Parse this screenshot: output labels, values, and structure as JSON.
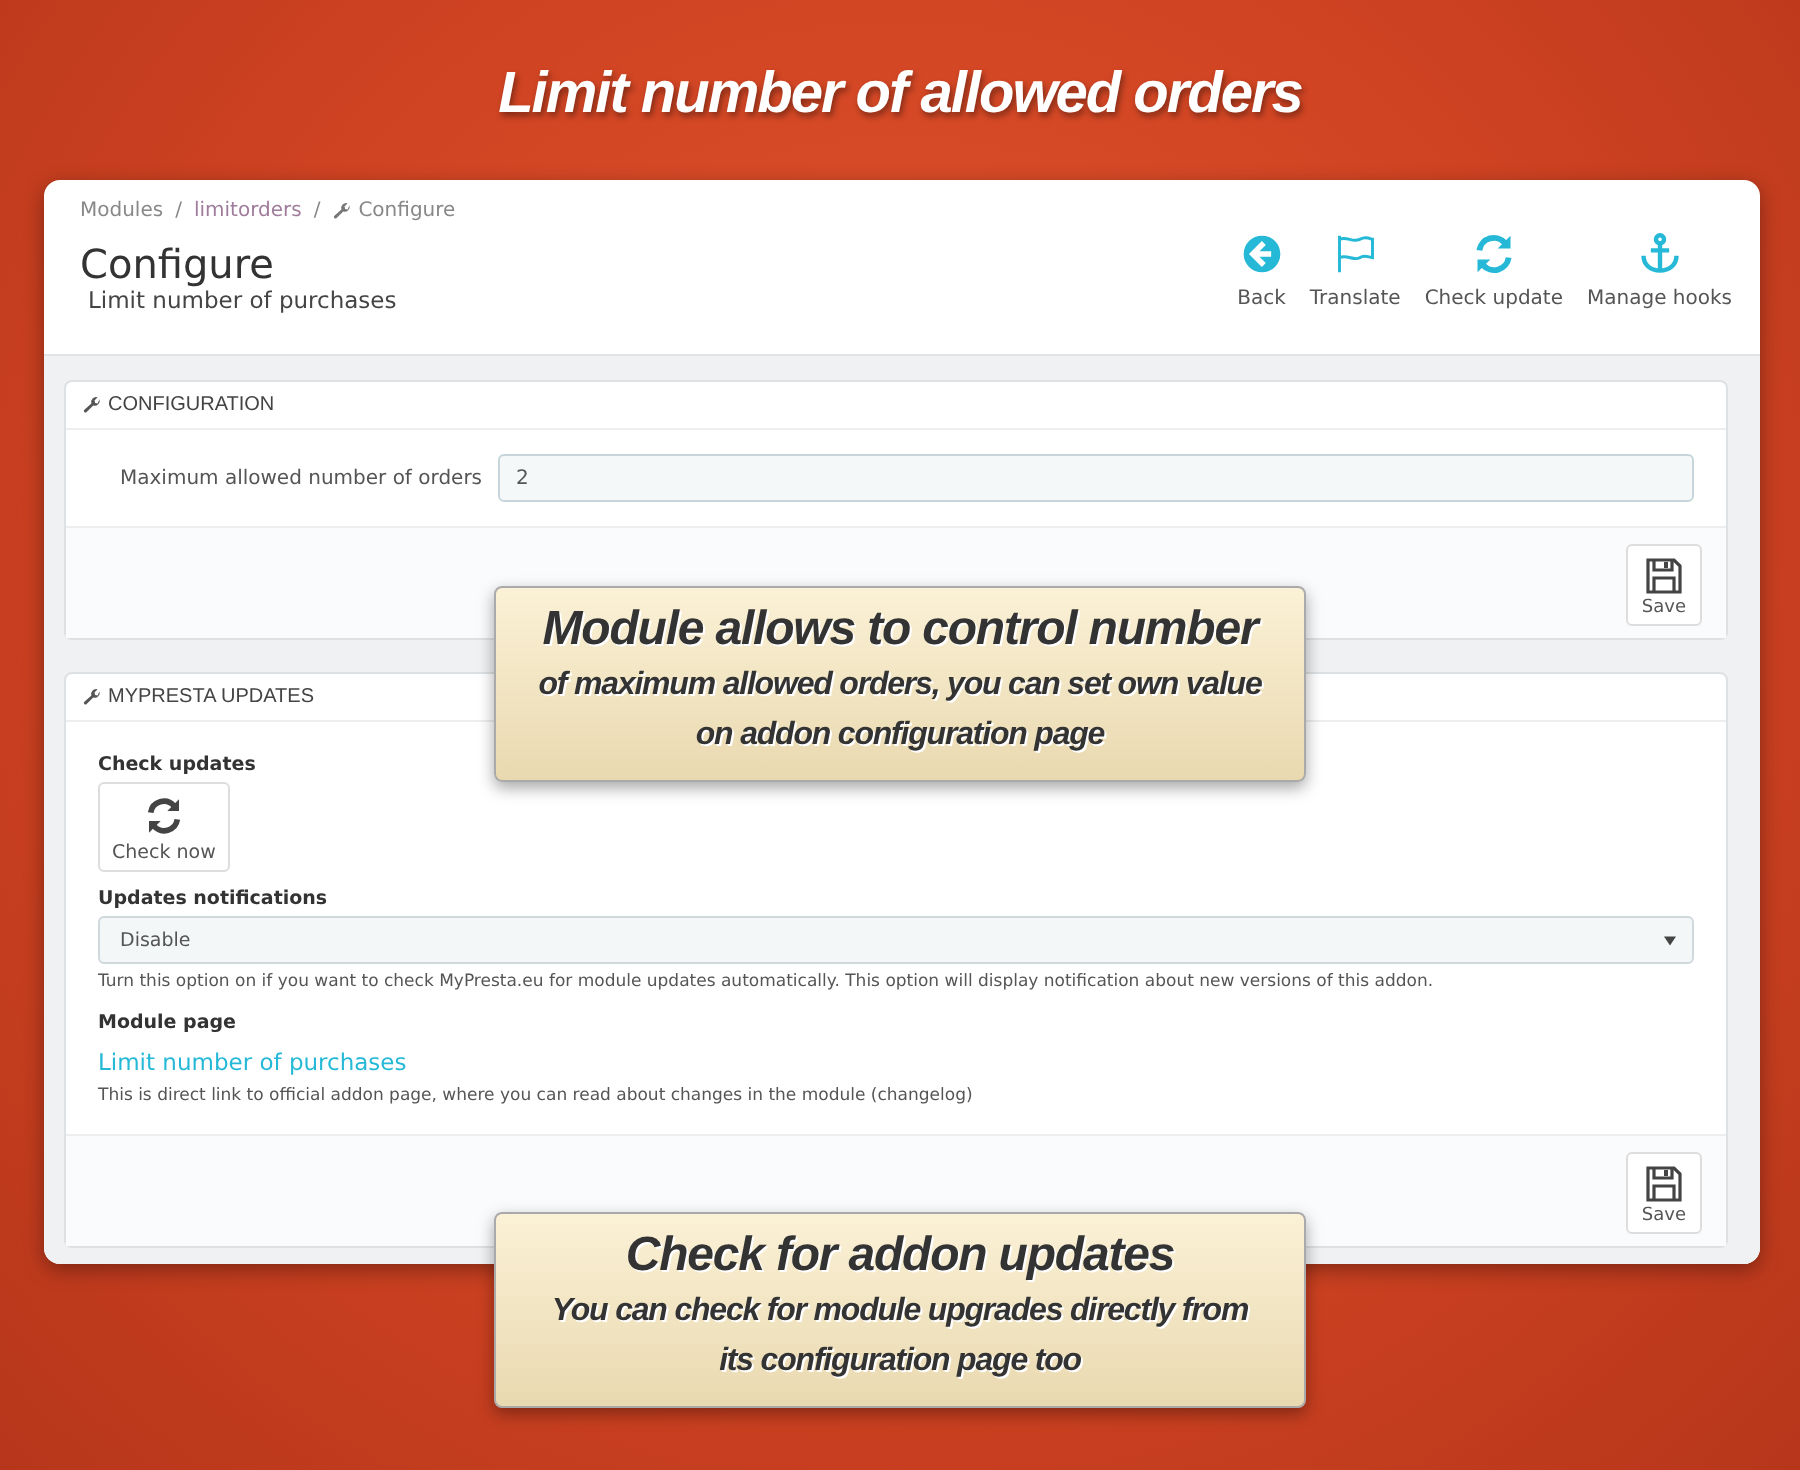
{
  "heading": "Limit number of allowed orders",
  "breadcrumb": [
    {
      "label": "Modules",
      "kind": "text"
    },
    {
      "label": "/",
      "kind": "separator"
    },
    {
      "label": "limitorders",
      "kind": "link"
    },
    {
      "label": "/",
      "kind": "separator"
    },
    {
      "label": "Configure",
      "kind": "current"
    }
  ],
  "page": {
    "title": "Configure",
    "subtitle": "Limit number of purchases"
  },
  "toolbar": [
    {
      "label": "Back",
      "kind": "back"
    },
    {
      "label": "Translate",
      "kind": "flag"
    },
    {
      "label": "Check update",
      "kind": "refresh"
    },
    {
      "label": "Manage hooks",
      "kind": "anchor"
    }
  ],
  "config_panel": {
    "title": "CONFIGURATION",
    "field_label": "Maximum allowed number of orders",
    "value": "2",
    "save": "Save"
  },
  "updates_panel": {
    "title": "MYPRESTA UPDATES",
    "check_label": "Check updates",
    "check_button": "Check now",
    "notif_label": "Updates notifications",
    "notif_value": "Disable",
    "notif_help": "Turn this option on if you want to check MyPresta.eu for module updates automatically. This option will display notification about new versions of this addon.",
    "page_label": "Module page",
    "page_link": "Limit number of purchases",
    "page_help": "This is direct link to official addon page, where you can read about changes in the module (changelog)",
    "save": "Save"
  },
  "callouts": [
    {
      "title": "Module allows to control number",
      "lines": [
        "of maximum allowed orders, you can set own value",
        "on addon configuration page"
      ]
    },
    {
      "title": "Check for addon updates",
      "lines": [
        "You can check for module upgrades directly from",
        "its configuration page too"
      ]
    }
  ]
}
